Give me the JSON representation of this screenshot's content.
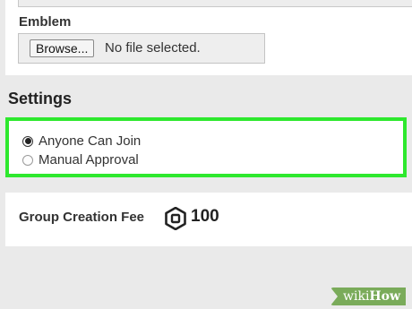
{
  "emblem": {
    "label": "Emblem",
    "browse_label": "Browse...",
    "file_status": "No file selected."
  },
  "settings": {
    "title": "Settings",
    "options": [
      {
        "label": "Anyone Can Join",
        "selected": true
      },
      {
        "label": "Manual Approval",
        "selected": false
      }
    ],
    "highlight_color": "#2ee82e"
  },
  "fee": {
    "label": "Group Creation Fee",
    "icon": "robux-icon",
    "amount": "100"
  },
  "watermark": {
    "prefix": "wiki",
    "suffix": "How"
  }
}
